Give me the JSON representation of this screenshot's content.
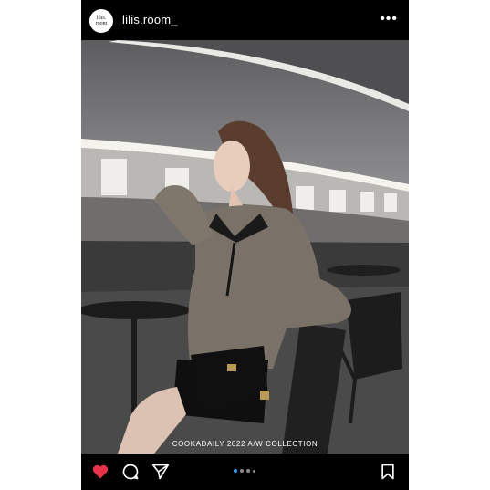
{
  "profile": {
    "username": "lilis.room_",
    "avatar_line1": "lilis.",
    "avatar_line2": "room"
  },
  "menu_icon": "more-horizontal-icon",
  "post": {
    "caption": "COOKADAILY 2022 A/W COLLECTION",
    "carousel": {
      "count": 4,
      "active_index": 0
    }
  },
  "actions": {
    "like_icon": "heart-icon",
    "comment_icon": "comment-icon",
    "share_icon": "send-icon",
    "save_icon": "bookmark-icon"
  },
  "colors": {
    "like": "#e8344a",
    "carousel_active": "#3897f0"
  }
}
